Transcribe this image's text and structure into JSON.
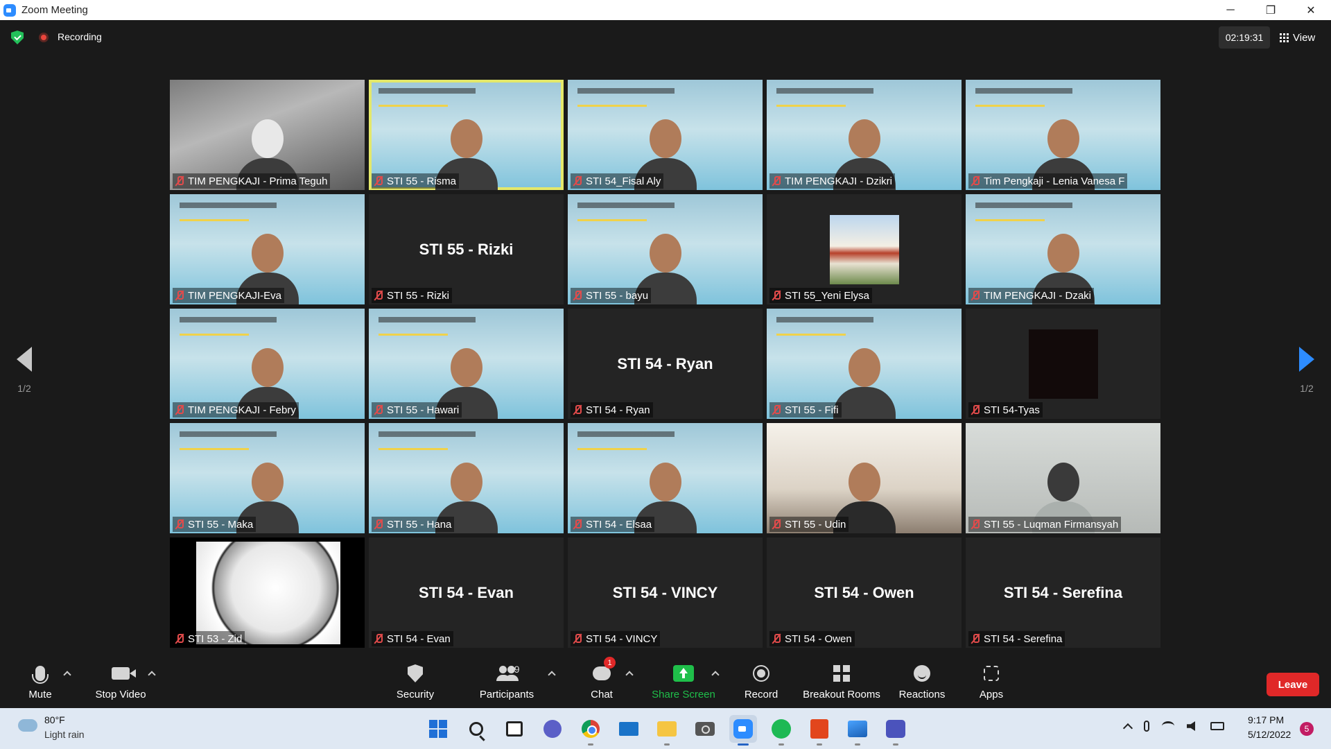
{
  "window": {
    "title": "Zoom Meeting",
    "controls": {
      "minimize": "─",
      "restore": "❐",
      "close": "✕"
    }
  },
  "topbar": {
    "recording_label": "Recording",
    "timer": "02:19:31",
    "view_label": "View"
  },
  "nav": {
    "page_left": "1/2",
    "page_right": "1/2"
  },
  "tiles": [
    {
      "name": "TIM PENGKAJI - Prima Teguh",
      "type": "photo"
    },
    {
      "name": "STI 55 - Risma",
      "type": "video",
      "active": true
    },
    {
      "name": "STI 54_Fisal Aly",
      "type": "video"
    },
    {
      "name": "TIM PENGKAJI - Dzikri",
      "type": "video"
    },
    {
      "name": "Tim Pengkaji - Lenia Vanesa F",
      "type": "video"
    },
    {
      "name": "TIM PENGKAJI-Eva",
      "type": "video"
    },
    {
      "name": "STI 55 - Rizki",
      "type": "name",
      "big_name": "STI 55 - Rizki"
    },
    {
      "name": "STI 55 - bayu",
      "type": "video"
    },
    {
      "name": "STI 55_Yeni Elysa",
      "type": "thumb"
    },
    {
      "name": "TIM PENGKAJI - Dzaki",
      "type": "video"
    },
    {
      "name": "TIM PENGKAJI - Febry",
      "type": "video"
    },
    {
      "name": "STI 55 - Hawari",
      "type": "video"
    },
    {
      "name": "STI 54 - Ryan",
      "type": "name",
      "big_name": "STI 54 - Ryan"
    },
    {
      "name": "STI 55 - Fifi",
      "type": "video"
    },
    {
      "name": "STI 54-Tyas",
      "type": "darksq"
    },
    {
      "name": "STI 55 - Maka",
      "type": "video"
    },
    {
      "name": "STI 55 - Hana",
      "type": "video"
    },
    {
      "name": "STI 54 - Elsaa",
      "type": "video"
    },
    {
      "name": "STI 55 - Udin",
      "type": "room"
    },
    {
      "name": "STI 55 - Luqman Firmansyah",
      "type": "face"
    },
    {
      "name": "STI 53 - Zid",
      "type": "clock"
    },
    {
      "name": "STI 54 - Evan",
      "type": "name",
      "big_name": "STI 54 - Evan"
    },
    {
      "name": "STI 54 - VINCY",
      "type": "name",
      "big_name": "STI 54 - VINCY"
    },
    {
      "name": "STI 54 - Owen",
      "type": "name",
      "big_name": "STI 54 - Owen"
    },
    {
      "name": "STI 54 - Serefina",
      "type": "name",
      "big_name": "STI 54 - Serefina"
    }
  ],
  "toolbar": {
    "mute": "Mute",
    "stop_video": "Stop Video",
    "security": "Security",
    "participants": "Participants",
    "participants_count": "49",
    "chat": "Chat",
    "chat_badge": "1",
    "share_screen": "Share Screen",
    "record": "Record",
    "breakout_rooms": "Breakout Rooms",
    "reactions": "Reactions",
    "apps": "Apps",
    "leave": "Leave"
  },
  "taskbar": {
    "weather_temp": "80°F",
    "weather_desc": "Light rain",
    "time": "9:17 PM",
    "date": "5/12/2022",
    "notification_count": "5",
    "apps": [
      "start-icon",
      "search-icon",
      "task-view-icon",
      "meet-icon",
      "chrome-icon",
      "mail-icon",
      "file-explorer-icon",
      "camera-icon",
      "zoom-icon",
      "spotify-icon",
      "pdf-icon",
      "photos-icon",
      "teams-icon"
    ]
  },
  "colors": {
    "accent_blue": "#2d8cff",
    "share_green": "#1fbf4a",
    "leave_red": "#e02828",
    "active_speaker": "#e4e86a"
  }
}
